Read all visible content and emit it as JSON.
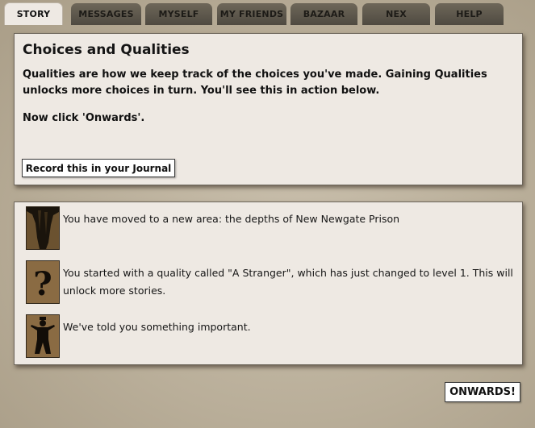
{
  "tabs": [
    {
      "label": "STORY",
      "active": true
    },
    {
      "label": "MESSAGES",
      "active": false
    },
    {
      "label": "MYSELF",
      "active": false
    },
    {
      "label": "MY FRIENDS",
      "active": false
    },
    {
      "label": "BAZAAR",
      "active": false
    },
    {
      "label": "NEX",
      "active": false
    },
    {
      "label": "HELP",
      "active": false
    }
  ],
  "intro": {
    "title": "Choices and Qualities",
    "paragraph1": "Qualities are how we keep track of the choices you've made. Gaining Qualities unlocks more choices in turn. You'll see this in action below.",
    "paragraph2": "Now click 'Onwards'.",
    "journal_button": "Record this in your Journal"
  },
  "results": [
    {
      "icon": "prison-depths-icon",
      "text": "You have moved to a new area: the depths of New Newgate Prison"
    },
    {
      "icon": "question-mark-icon",
      "text": "You started with a quality called \"A Stranger\", which has just changed to level 1. This will unlock more stories."
    },
    {
      "icon": "silhouette-figure-icon",
      "text": "We've told you something important."
    }
  ],
  "onwards_button": "ONWARDS!",
  "colors": {
    "background": "#b3a792",
    "panel": "#eee9e3",
    "tab_inactive": "#5f594d",
    "thumb": "#7a5f3c"
  }
}
